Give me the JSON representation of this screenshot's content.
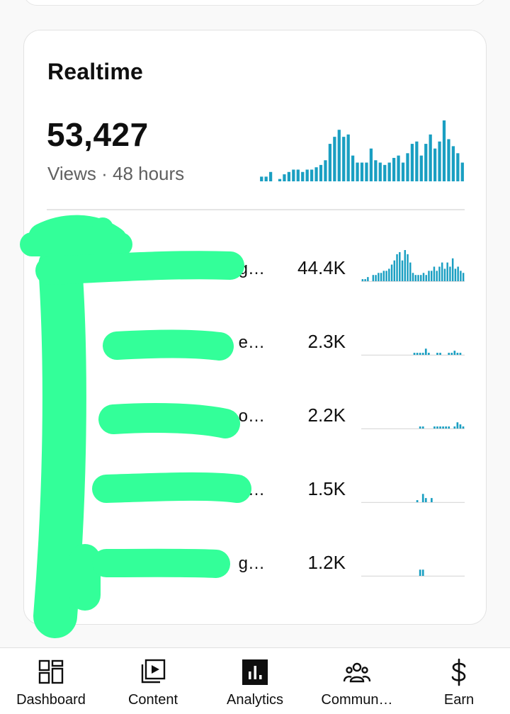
{
  "realtime": {
    "title": "Realtime",
    "total_views": "53,427",
    "views_line": "Views · 48 hours",
    "chart_data": {
      "type": "bar",
      "values": [
        2,
        2,
        4,
        0,
        1,
        3,
        4,
        5,
        5,
        4,
        5,
        5,
        6,
        7,
        9,
        16,
        19,
        22,
        19,
        20,
        11,
        8,
        8,
        8,
        14,
        9,
        8,
        7,
        8,
        10,
        11,
        8,
        12,
        16,
        17,
        11,
        16,
        20,
        14,
        17,
        26,
        18,
        15,
        12,
        8
      ]
    },
    "accent_color": "#1a9fc2",
    "rows": [
      {
        "title_fragment": "g…",
        "views": "44.4K",
        "values": [
          1,
          1,
          2,
          0,
          3,
          3,
          4,
          4,
          5,
          5,
          6,
          8,
          10,
          13,
          14,
          10,
          15,
          13,
          9,
          4,
          3,
          3,
          3,
          4,
          3,
          5,
          5,
          7,
          5,
          7,
          9,
          6,
          9,
          7,
          11,
          6,
          7,
          5,
          4
        ]
      },
      {
        "title_fragment": "e…",
        "views": "2.3K",
        "values": [
          0,
          0,
          0,
          0,
          0,
          0,
          0,
          0,
          0,
          0,
          0,
          0,
          0,
          0,
          0,
          0,
          0,
          0,
          1,
          1,
          1,
          1,
          3,
          1,
          0,
          0,
          1,
          1,
          0,
          0,
          1,
          1,
          2,
          1,
          1,
          0
        ]
      },
      {
        "title_fragment": "o…",
        "views": "2.2K",
        "values": [
          0,
          0,
          0,
          0,
          0,
          0,
          0,
          0,
          0,
          0,
          0,
          0,
          0,
          0,
          0,
          0,
          0,
          0,
          0,
          0,
          1,
          1,
          0,
          0,
          0,
          1,
          1,
          1,
          1,
          1,
          1,
          0,
          1,
          3,
          2,
          1
        ]
      },
      {
        "title_fragment": "…",
        "views": "1.5K",
        "values": [
          0,
          0,
          0,
          0,
          0,
          0,
          0,
          0,
          0,
          0,
          0,
          0,
          0,
          0,
          0,
          0,
          0,
          0,
          0,
          1,
          0,
          4,
          2,
          0,
          2,
          0,
          0,
          0,
          0,
          0,
          0,
          0,
          0,
          0,
          0,
          0
        ]
      },
      {
        "title_fragment": "g…",
        "views": "1.2K",
        "values": [
          0,
          0,
          0,
          0,
          0,
          0,
          0,
          0,
          0,
          0,
          0,
          0,
          0,
          0,
          0,
          0,
          0,
          0,
          0,
          0,
          3,
          3,
          0,
          0,
          0,
          0,
          0,
          0,
          0,
          0,
          0,
          0,
          0,
          0,
          0,
          0
        ]
      }
    ]
  },
  "nav": {
    "items": [
      {
        "label": "Dashboard",
        "icon": "dashboard-icon"
      },
      {
        "label": "Content",
        "icon": "content-icon"
      },
      {
        "label": "Analytics",
        "icon": "analytics-icon"
      },
      {
        "label": "Commun…",
        "icon": "community-icon"
      },
      {
        "label": "Earn",
        "icon": "earn-icon"
      }
    ]
  }
}
